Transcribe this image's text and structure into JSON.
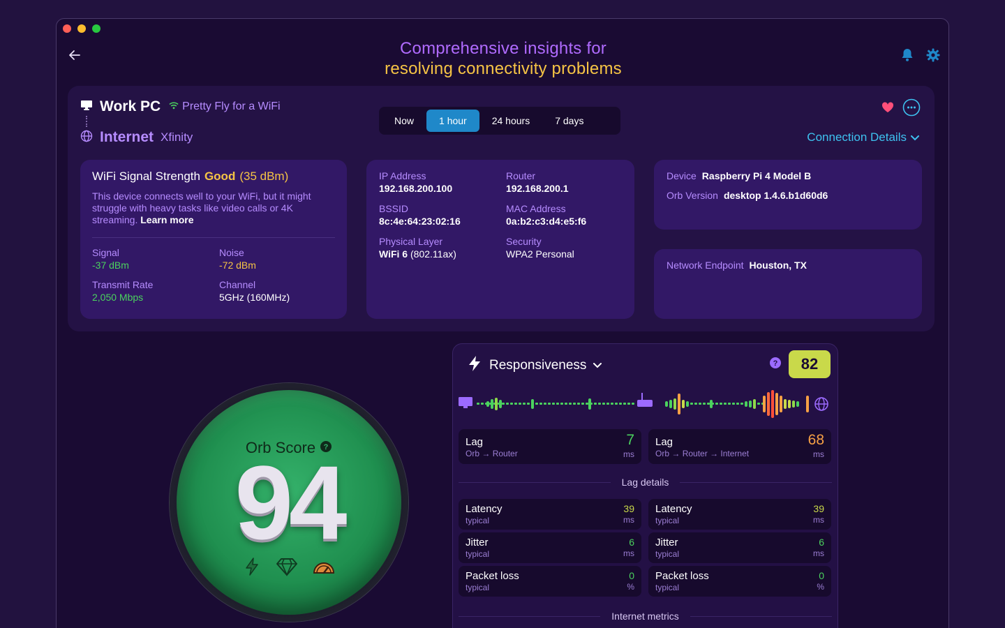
{
  "window": {
    "traffic_lights": [
      "close",
      "minimize",
      "maximize"
    ]
  },
  "header": {
    "title_line1": "Comprehensive insights for",
    "title_line2": "resolving connectivity problems"
  },
  "device": {
    "name": "Work PC",
    "wifi_name": "Pretty Fly for a WiFi",
    "network_label": "Internet",
    "isp": "Xfinity"
  },
  "time_range": {
    "options": [
      "Now",
      "1 hour",
      "24 hours",
      "7 days"
    ],
    "selected": "1 hour"
  },
  "connection_details_label": "Connection Details",
  "wifi_card": {
    "title": "WiFi Signal Strength",
    "rating": "Good",
    "rating_dbm": "(35 dBm)",
    "description": "This device connects well to your WiFi, but it might struggle with heavy tasks like video calls or 4K streaming.",
    "learn_more": "Learn more",
    "stats": [
      {
        "label": "Signal",
        "value": "-37 dBm",
        "color": "#4bd25e"
      },
      {
        "label": "Noise",
        "value": "-72 dBm",
        "color": "#f6c445"
      },
      {
        "label": "Transmit Rate",
        "value": "2,050 Mbps",
        "color": "#4bd25e"
      },
      {
        "label": "Channel",
        "value": "5GHz (160MHz)",
        "color": "#ffffff"
      }
    ]
  },
  "ip_card": {
    "ip_label": "IP Address",
    "ip_value": "192.168.200.100",
    "router_label": "Router",
    "router_value": "192.168.200.1",
    "bssid_label": "BSSID",
    "bssid_value": "8c:4e:64:23:02:16",
    "mac_label": "MAC Address",
    "mac_value": "0a:b2:c3:d4:e5:f6",
    "phys_label": "Physical Layer",
    "phys_value_bold": "WiFi 6",
    "phys_value_rest": "(802.11ax)",
    "security_label": "Security",
    "security_value": "WPA2 Personal"
  },
  "device_card": {
    "device_label": "Device",
    "device_value": "Raspberry Pi 4 Model B",
    "orb_version_label": "Orb Version",
    "orb_version_value": "desktop 1.4.6.b1d60d6"
  },
  "endpoint_card": {
    "label": "Network Endpoint",
    "value": "Houston, TX"
  },
  "orb": {
    "title": "Orb Score",
    "score": "94",
    "icons": [
      "bolt-icon",
      "diamond-icon",
      "speedometer-icon"
    ]
  },
  "responsiveness": {
    "title": "Responsiveness",
    "score": "82",
    "lag_left": {
      "title": "Lag",
      "from": "Orb",
      "to": "Router",
      "value": "7",
      "unit": "ms",
      "color": "#4bd25e"
    },
    "lag_right": {
      "title": "Lag",
      "from": "Orb",
      "mid": "Router",
      "to": "Internet",
      "value": "68",
      "unit": "ms",
      "color": "#f6a045"
    },
    "lag_details_label": "Lag details",
    "metrics_left": [
      {
        "title": "Latency",
        "sub": "typical",
        "value": "39",
        "unit": "ms",
        "color": "#c9d94a"
      },
      {
        "title": "Jitter",
        "sub": "typical",
        "value": "6",
        "unit": "ms",
        "color": "#4bd25e"
      },
      {
        "title": "Packet loss",
        "sub": "typical",
        "value": "0",
        "unit": "%",
        "color": "#4bd25e"
      }
    ],
    "metrics_right": [
      {
        "title": "Latency",
        "sub": "typical",
        "value": "39",
        "unit": "ms",
        "color": "#c9d94a"
      },
      {
        "title": "Jitter",
        "sub": "typical",
        "value": "6",
        "unit": "ms",
        "color": "#4bd25e"
      },
      {
        "title": "Packet loss",
        "sub": "typical",
        "value": "0",
        "unit": "%",
        "color": "#4bd25e"
      }
    ],
    "internet_metrics_label": "Internet metrics"
  }
}
